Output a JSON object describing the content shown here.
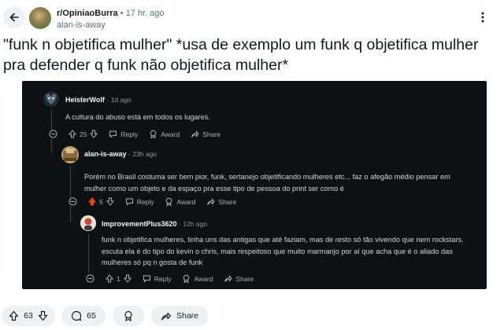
{
  "header": {
    "subreddit": "r/OpiniaoBurra",
    "separator": "•",
    "time": "17 hr. ago",
    "author": "alan-is-away"
  },
  "post": {
    "title": "\"funk n objetifica mulher\" *usa de exemplo um funk q objetifica mulher pra defender q funk não objetifica mulher*"
  },
  "screenshot": {
    "comments": [
      {
        "user": "HeisterWolf",
        "time": "1d ago",
        "text": "A cultura do abuso está em todos os lugares.",
        "votes": "25",
        "reply": "Reply",
        "award": "Award",
        "share": "Share"
      },
      {
        "user": "alan-is-away",
        "time": "23h ago",
        "text": "Porém no Brasil costuma ser bem pior, funk, sertanejo objetificando mulheres etc... faz o afegão médio pensar em mulher como um objeto e da espaço pra esse tipo de pessoa do print ser como é",
        "votes": "5",
        "reply": "Reply",
        "award": "Award",
        "share": "Share"
      },
      {
        "user": "ImprovementPlus3620",
        "time": "12h ago",
        "text": "funk n objetifica mulheres, tinha uns das antigas que até faziam, mas de resto só tão vivendo que nem rockstars. escuta ela é do tipo do kevin o chris, mais respeitoso que muito marmanjo por aí que acha que é o aliado das mulheres só pq n gosta de funk",
        "votes": "1",
        "reply": "Reply",
        "award": "Award",
        "share": "Share"
      }
    ]
  },
  "footer": {
    "votes": "63",
    "comments": "65",
    "share": "Share"
  },
  "colors": {
    "upvoted": "#ff4500",
    "screenshot_bg": "#0e1113"
  }
}
